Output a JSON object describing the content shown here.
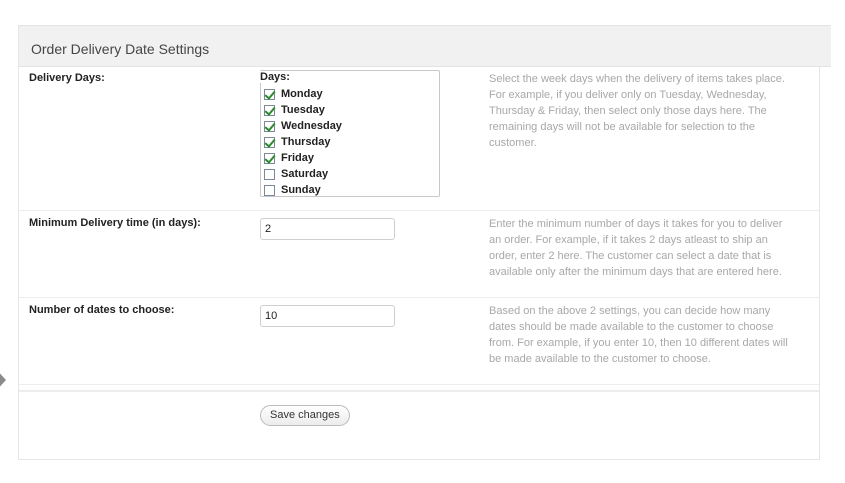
{
  "header": {
    "title": "Order Delivery Date Settings"
  },
  "delivery_days": {
    "label": "Delivery Days:",
    "legend": "Days:",
    "days": [
      {
        "label": "Monday",
        "checked": true
      },
      {
        "label": "Tuesday",
        "checked": true
      },
      {
        "label": "Wednesday",
        "checked": true
      },
      {
        "label": "Thursday",
        "checked": true
      },
      {
        "label": "Friday",
        "checked": true
      },
      {
        "label": "Saturday",
        "checked": false
      },
      {
        "label": "Sunday",
        "checked": false
      }
    ],
    "help": "Select the week days when the delivery of items takes place. For example, if you deliver only on Tuesday, Wednesday, Thursday & Friday, then select only those days here. The remaining days will not be available for selection to the customer."
  },
  "min_delivery": {
    "label": "Minimum Delivery time (in days):",
    "value": "2",
    "help": "Enter the minimum number of days it takes for you to deliver an order. For example, if it takes 2 days atleast to ship an order, enter 2 here. The customer can select a date that is available only after the minimum days that are entered here."
  },
  "num_dates": {
    "label": "Number of dates to choose:",
    "value": "10",
    "help": "Based on the above 2 settings, you can decide how many dates should be made available to the customer to choose from. For example, if you enter 10, then 10 different dates will be made available to the customer to choose."
  },
  "actions": {
    "save_label": "Save changes"
  }
}
